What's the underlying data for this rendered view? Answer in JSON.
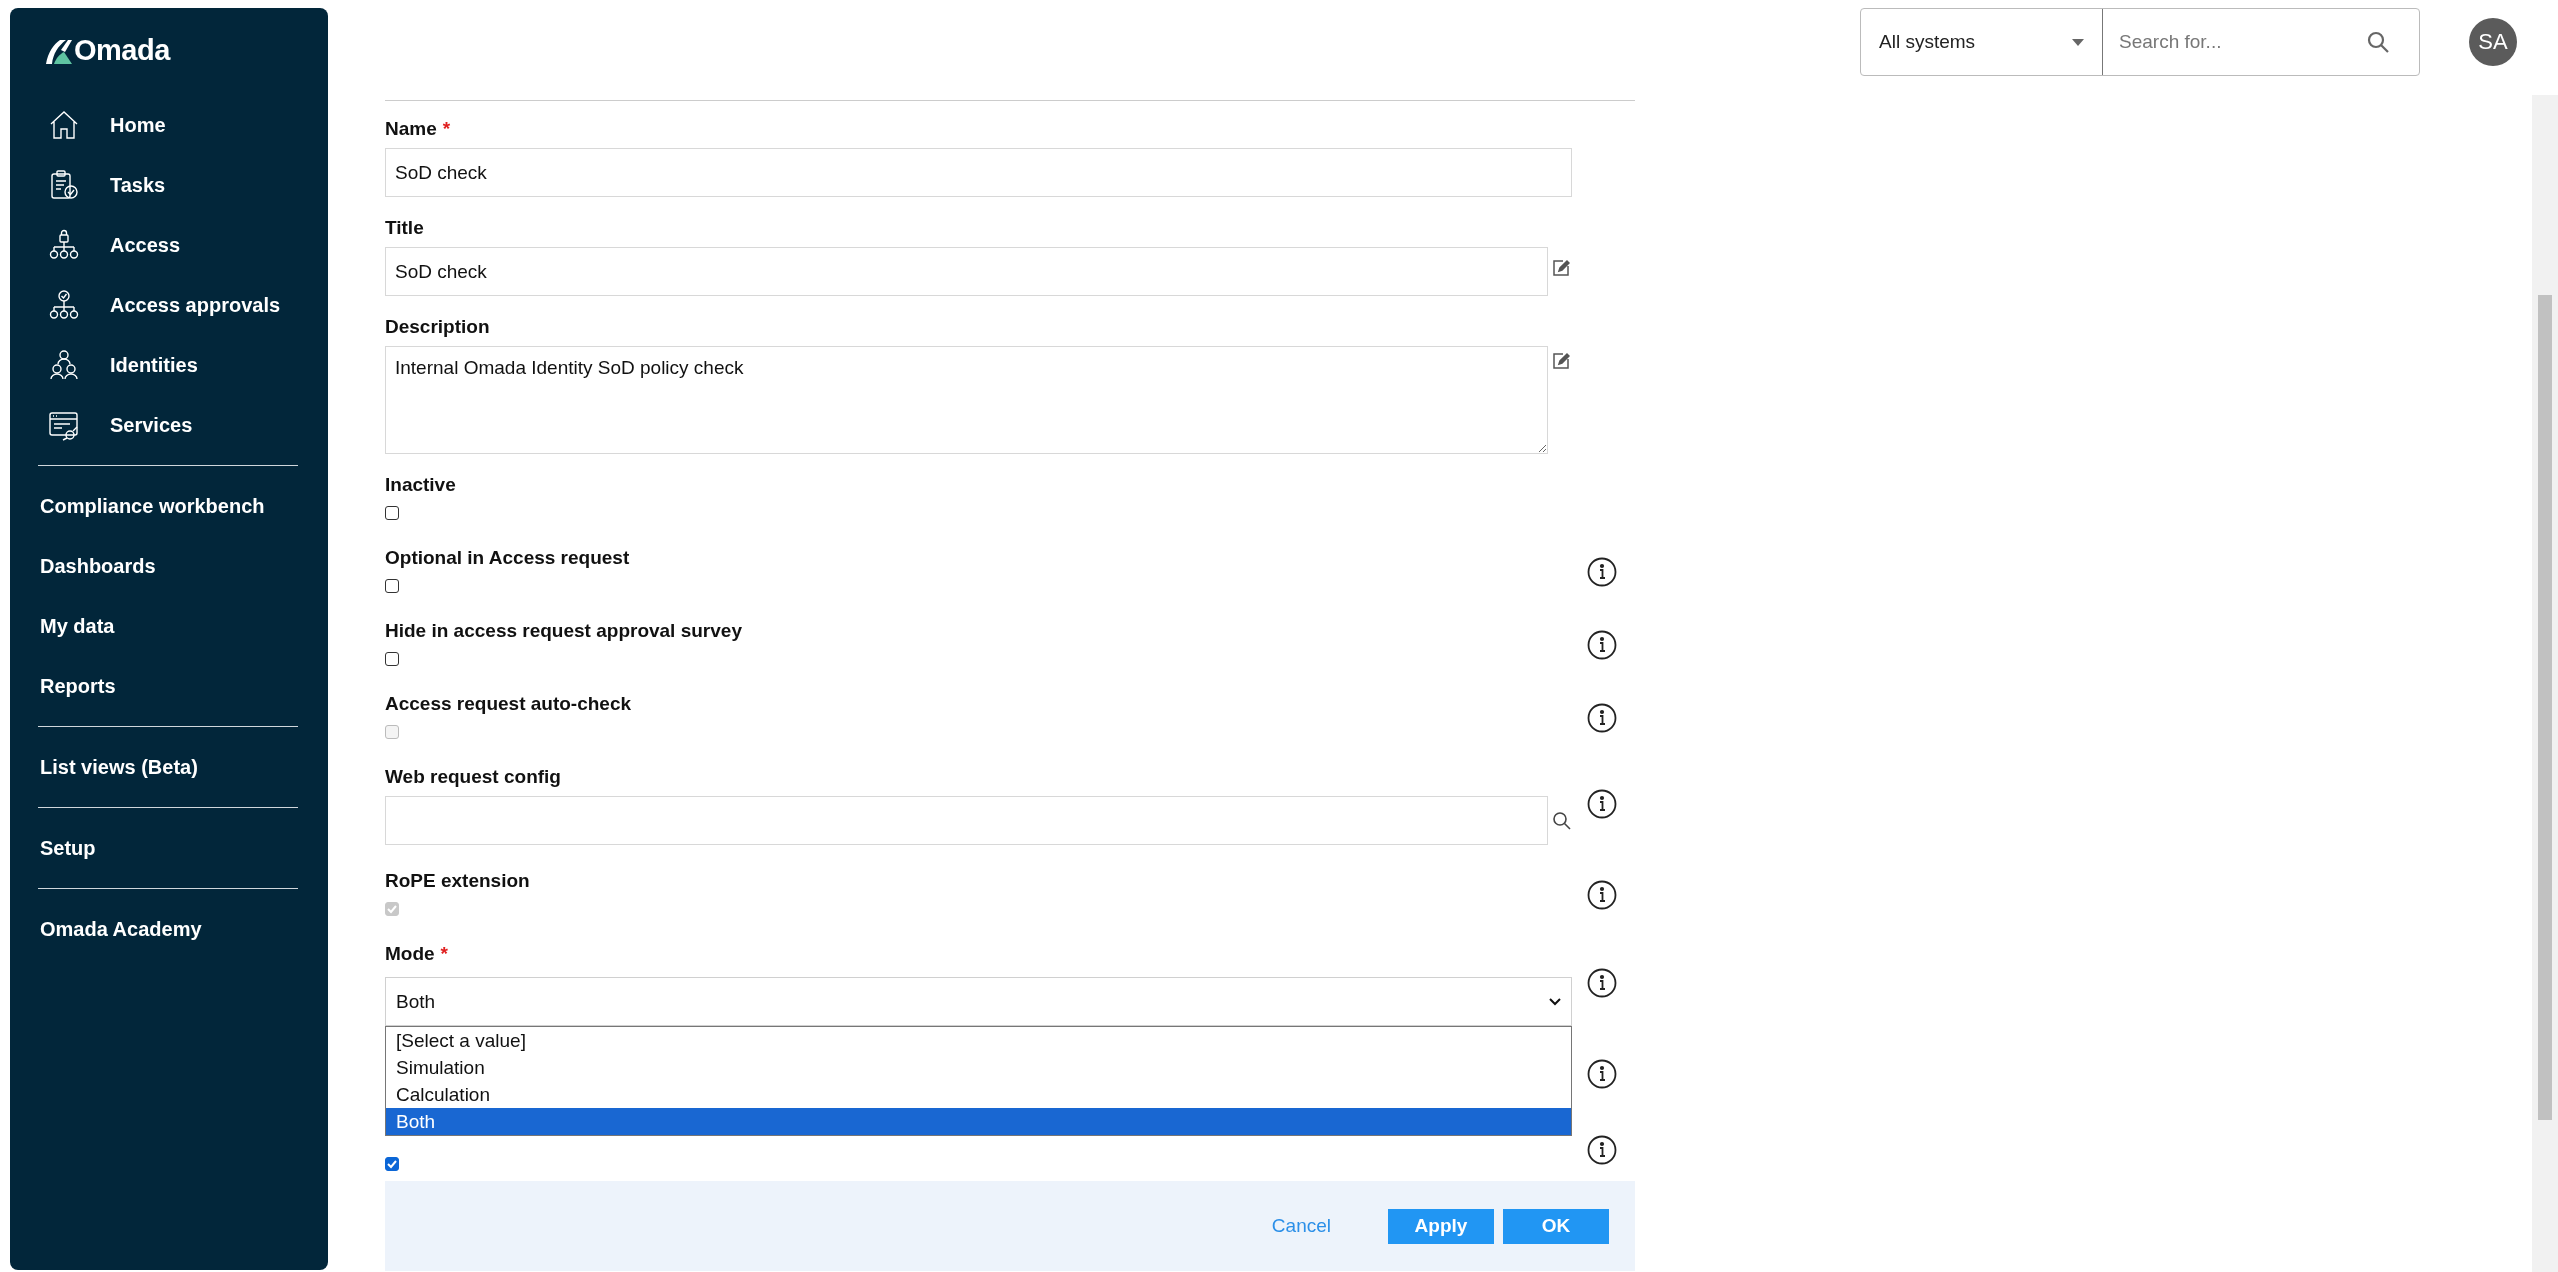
{
  "sidebar": {
    "logo": "Omada",
    "nav_items": [
      {
        "label": "Home"
      },
      {
        "label": "Tasks"
      },
      {
        "label": "Access"
      },
      {
        "label": "Access approvals"
      },
      {
        "label": "Identities"
      },
      {
        "label": "Services"
      }
    ],
    "sections": [
      [
        "Compliance workbench",
        "Dashboards",
        "My data",
        "Reports"
      ],
      [
        "List views (Beta)"
      ],
      [
        "Setup"
      ],
      [
        "Omada Academy"
      ]
    ]
  },
  "topbar": {
    "system_select": "All systems",
    "search": {
      "placeholder": "Search for..."
    },
    "avatar": "SA"
  },
  "form": {
    "fields": [
      {
        "kind": "text",
        "label": "Name",
        "required_mark": "*",
        "value": "SoD check"
      },
      {
        "kind": "text",
        "label": "Title",
        "value": "SoD check",
        "edit": true
      },
      {
        "kind": "textarea",
        "label": "Description",
        "value": "Internal Omada Identity SoD policy check",
        "edit": true
      },
      {
        "kind": "checkbox",
        "label": "Inactive",
        "checked": false,
        "disabled": false
      },
      {
        "kind": "checkbox",
        "label": "Optional in Access request",
        "checked": false,
        "disabled": false,
        "info": true
      },
      {
        "kind": "checkbox",
        "label": "Hide in access request approval survey",
        "checked": false,
        "disabled": false,
        "info": true
      },
      {
        "kind": "checkbox",
        "label": "Access request auto-check",
        "checked": false,
        "disabled": true,
        "info": true
      },
      {
        "kind": "lookup",
        "label": "Web request config",
        "info": true
      },
      {
        "kind": "checkbox",
        "label": "RoPE extension",
        "checked": true,
        "disabled": true,
        "info": true
      },
      {
        "kind": "select",
        "label": "Mode",
        "required_mark": "*",
        "value": "Both",
        "info": true,
        "expanded": true,
        "options": [
          {
            "label": "[Select a value]",
            "selected": false
          },
          {
            "label": "Simulation",
            "selected": false
          },
          {
            "label": "Calculation",
            "selected": false
          },
          {
            "label": "Both",
            "selected": true
          }
        ]
      },
      {
        "kind": "covered",
        "info": true
      },
      {
        "kind": "checkbox",
        "checked": true,
        "disabled": false,
        "info": true
      }
    ],
    "buttons": [
      {
        "label": "Cancel",
        "kind": "link"
      },
      {
        "label": "Apply",
        "kind": "primary"
      },
      {
        "label": "OK",
        "kind": "primary"
      }
    ]
  }
}
